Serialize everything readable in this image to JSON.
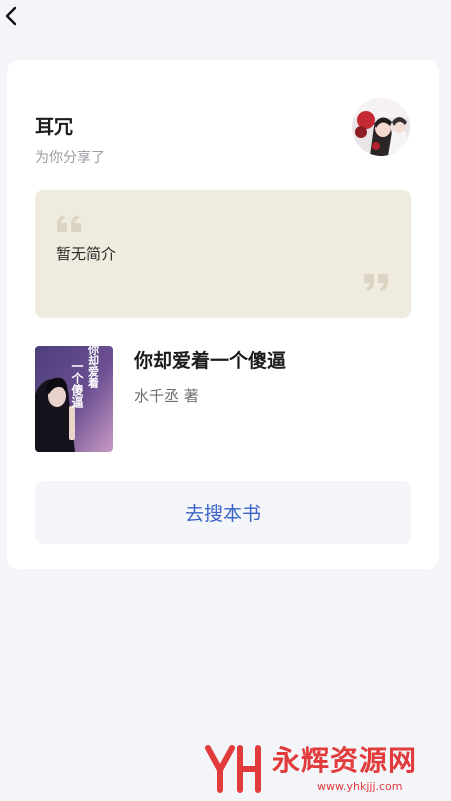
{
  "navigation": {
    "back_icon": "chevron-left-icon"
  },
  "share": {
    "sharer_name": "耳冗",
    "share_note": "为你分享了",
    "avatar": "avatar-anime-illustration"
  },
  "intro": {
    "text": "暂无简介",
    "quote_open_icon": "quote-open-icon",
    "quote_close_icon": "quote-close-icon"
  },
  "book": {
    "title": "你却爱着一个傻逼",
    "author_line": "水千丞 著",
    "cover": {
      "title_line_1": "你却爱着",
      "title_line_2": "一个傻逼"
    }
  },
  "actions": {
    "search_label": "去搜本书"
  },
  "watermark": {
    "logo": "YH",
    "name": "永辉资源网",
    "url": "www.yhkjjj.com"
  },
  "colors": {
    "page_background": "#f4f5f9",
    "card_background": "#ffffff",
    "quote_background": "#f0ebdf",
    "quote_mark": "#dcd4c2",
    "link_blue": "#3a63c9",
    "watermark_red": "#e23b3b"
  }
}
